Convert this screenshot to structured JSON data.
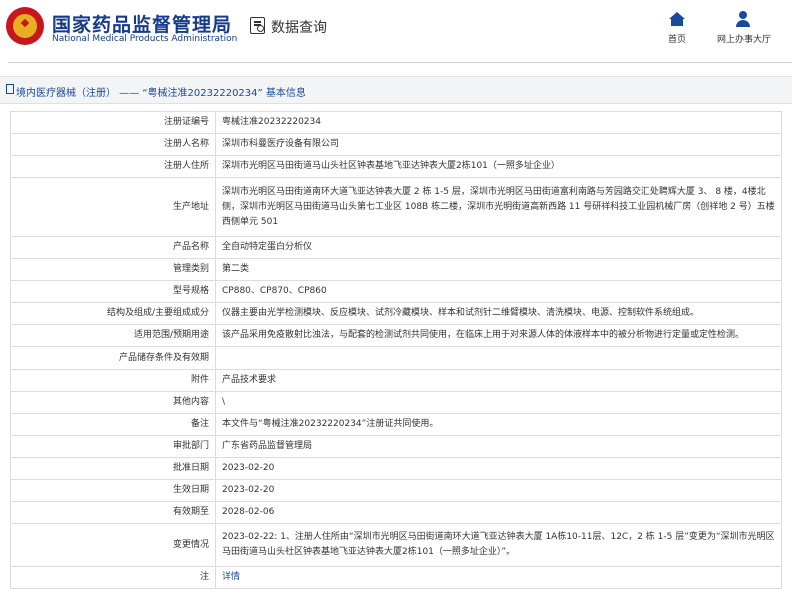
{
  "header": {
    "title_cn": "国家药品监督管理局",
    "title_en": "National Medical Products Administration",
    "query_title": "数据查询",
    "nav": [
      {
        "label": "首页",
        "icon": "home-icon"
      },
      {
        "label": "网上办事大厅",
        "icon": "user-icon"
      }
    ]
  },
  "breadcrumb": "境内医疗器械（注册） ——  “粤械注准20232220234”  基本信息",
  "rows": [
    {
      "key": "注册证编号",
      "value": "粤械注准20232220234"
    },
    {
      "key": "注册人名称",
      "value": "深圳市科曼医疗设备有限公司"
    },
    {
      "key": "注册人住所",
      "value": "深圳市光明区马田街道马山头社区钟表基地飞亚达钟表大厦2栋101（一照多址企业）"
    },
    {
      "key": "生产地址",
      "value": "深圳市光明区马田街道南环大道飞亚达钟表大厦 2 栋 1-5 层，深圳市光明区马田街道富利南路与芳园路交汇处聘辉大厦 3、 8 楼，4楼北侧，深圳市光明区马田街道马山头第七工业区 108B 栋二楼，深圳市光明街道高新西路 11 号研祥科技工业园机械厂房（创祥地 2 号）五楼西侧单元 501"
    },
    {
      "key": "产品名称",
      "value": "全自动特定蛋白分析仪"
    },
    {
      "key": "管理类别",
      "value": "第二类"
    },
    {
      "key": "型号规格",
      "value": "CP880、CP870、CP860"
    },
    {
      "key": "结构及组成/主要组成成分",
      "value": "仪器主要由光学检测模块、反应模块、试剂冷藏模块、样本和试剂针二维臂模块、清洗模块、电源、控制软件系统组成。"
    },
    {
      "key": "适用范围/预期用途",
      "value": "该产品采用免疫散射比浊法，与配套的检测试剂共同使用，在临床上用于对来源人体的体液样本中的被分析物进行定量或定性检测。"
    },
    {
      "key": "产品储存条件及有效期",
      "value": ""
    },
    {
      "key": "附件",
      "value": "产品技术要求"
    },
    {
      "key": "其他内容",
      "value": "\\"
    },
    {
      "key": "备注",
      "value": "本文件与“粤械注准20232220234”注册证共同使用。"
    },
    {
      "key": "审批部门",
      "value": "广东省药品监督管理局"
    },
    {
      "key": "批准日期",
      "value": "2023-02-20"
    },
    {
      "key": "生效日期",
      "value": "2023-02-20"
    },
    {
      "key": "有效期至",
      "value": "2028-02-06"
    },
    {
      "key": "变更情况",
      "value": "2023-02-22: 1、注册人住所由“深圳市光明区马田街道南环大道飞亚达钟表大厦 1A栋10-11层、12C，2 栋 1-5 层”变更为“深圳市光明区马田街道马山头社区钟表基地飞亚达钟表大厦2栋101（一照多址企业）”。"
    },
    {
      "key": "注",
      "value": "详情"
    }
  ]
}
